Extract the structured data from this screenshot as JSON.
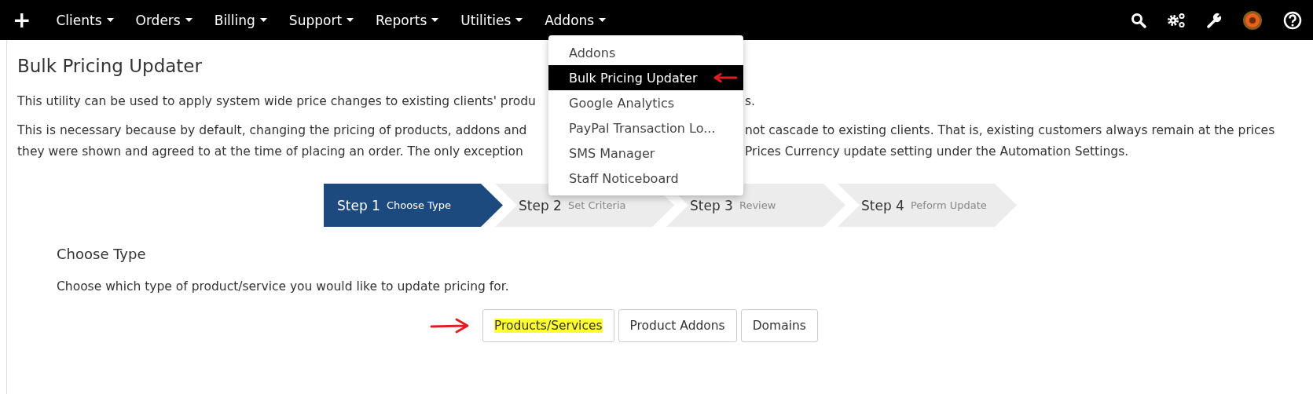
{
  "nav": {
    "add_label": "+",
    "items": [
      {
        "label": "Clients"
      },
      {
        "label": "Orders"
      },
      {
        "label": "Billing"
      },
      {
        "label": "Support"
      },
      {
        "label": "Reports"
      },
      {
        "label": "Utilities"
      },
      {
        "label": "Addons"
      }
    ]
  },
  "dropdown": {
    "items": [
      {
        "label": "Addons",
        "selected": false
      },
      {
        "label": "Bulk Pricing Updater",
        "selected": true
      },
      {
        "label": "Google Analytics",
        "selected": false
      },
      {
        "label": "PayPal Transaction Lo...",
        "selected": false
      },
      {
        "label": "SMS Manager",
        "selected": false
      },
      {
        "label": "Staff Noticeboard",
        "selected": false
      }
    ]
  },
  "page": {
    "title": "Bulk Pricing Updater",
    "paragraphs": [
      {
        "lines": [
          {
            "left": "This utility can be used to apply system wide price changes to existing clients' produ",
            "right": "s."
          }
        ]
      },
      {
        "lines": [
          {
            "left": "This is necessary because by default, changing the pricing of products, addons and",
            "right": "not cascade to existing clients. That is, existing customers always remain at the prices"
          },
          {
            "left": "they were shown and agreed to at the time of placing an order. The only exception",
            "right": "Prices Currency update setting under the Automation Settings."
          }
        ]
      }
    ]
  },
  "steps": [
    {
      "label": "Step 1",
      "subtitle": "Choose Type",
      "selected": true
    },
    {
      "label": "Step 2",
      "subtitle": "Set Criteria",
      "selected": false
    },
    {
      "label": "Step 3",
      "subtitle": "Review",
      "selected": false
    },
    {
      "label": "Step 4",
      "subtitle": "Peform Update",
      "selected": false
    }
  ],
  "choose": {
    "heading": "Choose Type",
    "description": "Choose which type of product/service you would like to update pricing for.",
    "buttons": [
      {
        "label": "Products/Services",
        "highlighted": true
      },
      {
        "label": "Product Addons",
        "highlighted": false
      },
      {
        "label": "Domains",
        "highlighted": false
      }
    ]
  }
}
